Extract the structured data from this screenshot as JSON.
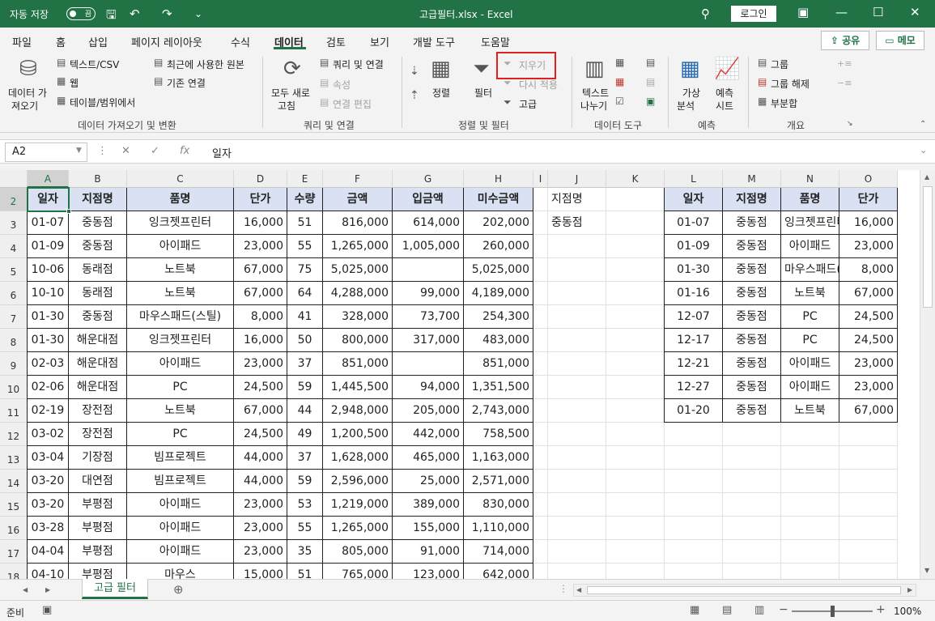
{
  "titlebar": {
    "autosave_label": "자동 저장",
    "toggle_state": "끔",
    "title": "고급필터.xlsx  -  Excel",
    "login": "로그인"
  },
  "tabs": [
    "파일",
    "홈",
    "삽입",
    "페이지 레이아웃",
    "수식",
    "데이터",
    "검토",
    "보기",
    "개발 도구",
    "도움말"
  ],
  "active_tab": "데이터",
  "share_label": "공유",
  "memo_label": "메모",
  "ribbon": {
    "get_data": "데이터 가져오기",
    "get_data_line1": "데이터 가",
    "get_data_line2": "져오기",
    "text_csv": "텍스트/CSV",
    "web": "웹",
    "table_range": "테이블/범위에서",
    "recent_sources": "최근에 사용한 원본",
    "existing_conn": "기존 연결",
    "group_get": "데이터 가져오기 및 변환",
    "refresh_all_1": "모두 새로",
    "refresh_all_2": "고침",
    "queries_conn": "쿼리 및 연결",
    "properties": "속성",
    "edit_links": "연결 편집",
    "group_queries": "쿼리 및 연결",
    "sort": "정렬",
    "filter": "필터",
    "clear": "지우기",
    "reapply": "다시 적용",
    "advanced": "고급",
    "group_sort": "정렬 및 필터",
    "text_to_cols_1": "텍스트",
    "text_to_cols_2": "나누기",
    "group_tools": "데이터 도구",
    "whatif_1": "가상",
    "whatif_2": "분석",
    "forecast_1": "예측",
    "forecast_2": "시트",
    "group_forecast": "예측",
    "group_btn": "그룹",
    "ungroup_btn": "그룹 해제",
    "subtotal": "부분합",
    "group_outline": "개요"
  },
  "namebox": "A2",
  "formula": "일자",
  "columns": [
    "A",
    "B",
    "C",
    "D",
    "E",
    "F",
    "G",
    "H",
    "I",
    "J",
    "K",
    "L",
    "M",
    "N",
    "O"
  ],
  "rows": [
    "2",
    "3",
    "4",
    "5",
    "6",
    "7",
    "8",
    "9",
    "10",
    "11",
    "12",
    "13",
    "14",
    "15",
    "16",
    "17",
    "18"
  ],
  "main_table": {
    "headers": [
      "일자",
      "지점명",
      "품명",
      "단가",
      "수량",
      "금액",
      "입금액",
      "미수금액"
    ],
    "rows": [
      [
        "01-07",
        "중동점",
        "잉크젯프린터",
        "16,000",
        "51",
        "816,000",
        "614,000",
        "202,000"
      ],
      [
        "01-09",
        "중동점",
        "아이패드",
        "23,000",
        "55",
        "1,265,000",
        "1,005,000",
        "260,000"
      ],
      [
        "10-06",
        "동래점",
        "노트북",
        "67,000",
        "75",
        "5,025,000",
        "",
        "5,025,000"
      ],
      [
        "10-10",
        "동래점",
        "노트북",
        "67,000",
        "64",
        "4,288,000",
        "99,000",
        "4,189,000"
      ],
      [
        "01-30",
        "중동점",
        "마우스패드(스틸)",
        "8,000",
        "41",
        "328,000",
        "73,700",
        "254,300"
      ],
      [
        "01-30",
        "해운대점",
        "잉크젯프린터",
        "16,000",
        "50",
        "800,000",
        "317,000",
        "483,000"
      ],
      [
        "02-03",
        "해운대점",
        "아이패드",
        "23,000",
        "37",
        "851,000",
        "",
        "851,000"
      ],
      [
        "02-06",
        "해운대점",
        "PC",
        "24,500",
        "59",
        "1,445,500",
        "94,000",
        "1,351,500"
      ],
      [
        "02-19",
        "장전점",
        "노트북",
        "67,000",
        "44",
        "2,948,000",
        "205,000",
        "2,743,000"
      ],
      [
        "03-02",
        "장전점",
        "PC",
        "24,500",
        "49",
        "1,200,500",
        "442,000",
        "758,500"
      ],
      [
        "03-04",
        "기장점",
        "빔프로젝트",
        "44,000",
        "37",
        "1,628,000",
        "465,000",
        "1,163,000"
      ],
      [
        "03-20",
        "대연점",
        "빔프로젝트",
        "44,000",
        "59",
        "2,596,000",
        "25,000",
        "2,571,000"
      ],
      [
        "03-20",
        "부평점",
        "아이패드",
        "23,000",
        "53",
        "1,219,000",
        "389,000",
        "830,000"
      ],
      [
        "03-28",
        "부평점",
        "아이패드",
        "23,000",
        "55",
        "1,265,000",
        "155,000",
        "1,110,000"
      ],
      [
        "04-04",
        "부평점",
        "아이패드",
        "23,000",
        "35",
        "805,000",
        "91,000",
        "714,000"
      ],
      [
        "04-10",
        "부평점",
        "마우스",
        "15,000",
        "51",
        "765,000",
        "123,000",
        "642,000"
      ]
    ]
  },
  "criteria": {
    "header": "지점명",
    "value": "중동점"
  },
  "result_table": {
    "headers": [
      "일자",
      "지점명",
      "품명",
      "단가"
    ],
    "rows": [
      [
        "01-07",
        "중동점",
        "잉크젯프린터",
        "16,000"
      ],
      [
        "01-09",
        "중동점",
        "아이패드",
        "23,000"
      ],
      [
        "01-30",
        "중동점",
        "마우스패드(스틸)",
        "8,000"
      ],
      [
        "01-16",
        "중동점",
        "노트북",
        "67,000"
      ],
      [
        "12-07",
        "중동점",
        "PC",
        "24,500"
      ],
      [
        "12-17",
        "중동점",
        "PC",
        "24,500"
      ],
      [
        "12-21",
        "중동점",
        "아이패드",
        "23,000"
      ],
      [
        "12-27",
        "중동점",
        "아이패드",
        "23,000"
      ],
      [
        "01-20",
        "중동점",
        "노트북",
        "67,000"
      ]
    ]
  },
  "sheet_tab": "고급 필터",
  "status": {
    "ready": "준비",
    "zoom": "100%"
  }
}
